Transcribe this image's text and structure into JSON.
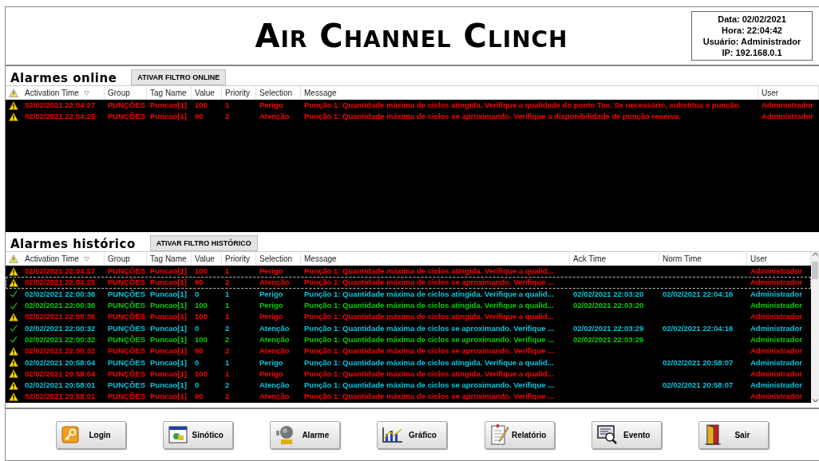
{
  "header": {
    "title": "Air Channel Clinch",
    "info": [
      "Data: 02/02/2021",
      "Hora: 22:04:42",
      "Usuário: Administrador",
      "IP: 192.168.0.1"
    ]
  },
  "online": {
    "title": "Alarmes online",
    "filter_button": "ATIVAR FILTRO ONLINE",
    "columns": [
      "Activation Time",
      "Group",
      "Tag Name",
      "Value",
      "Priority",
      "Selection",
      "Message",
      "User"
    ],
    "rows": [
      {
        "kind": "alarm",
        "color": "#ff0000",
        "cells": [
          "02/02/2021 22:04:27",
          "PUNÇÕES",
          "Puncao[1]",
          "100",
          "1",
          "Perigo",
          "Punção 1: Quantidade máxima de ciclos atingida. Verifique a qualidade do ponto Tox. Se necessário, substitua o punção.",
          "Administrador"
        ]
      },
      {
        "kind": "alarm",
        "color": "#ff0000",
        "cells": [
          "02/02/2021 22:04:25",
          "PUNÇÕES",
          "Puncao[1]",
          "90",
          "2",
          "Atenção",
          "Punção 1: Quantidade máxima de ciclos se aproximando. Verifique a disponibilidade de punção reserva.",
          "Administrador"
        ]
      }
    ]
  },
  "history": {
    "title": "Alarmes histórico",
    "filter_button": "ATIVAR FILTRO HISTÓRICO",
    "columns": [
      "Activation Time",
      "Group",
      "Tag Name",
      "Value",
      "Priority",
      "Selection",
      "Message",
      "Ack Time",
      "Norm Time",
      "User"
    ],
    "rows": [
      {
        "kind": "alarm",
        "color": "#ff0000",
        "selected": false,
        "cells": [
          "02/02/2021 22:04:27",
          "PUNÇÕES",
          "Puncao[1]",
          "100",
          "1",
          "Perigo",
          "Punção 1: Quantidade máxima de ciclos atingida. Verifique a qualid...",
          "",
          "",
          "Administrador"
        ]
      },
      {
        "kind": "alarm",
        "color": "#ff0000",
        "selected": true,
        "cells": [
          "02/02/2021 22:04:25",
          "PUNÇÕES",
          "Puncao[1]",
          "90",
          "2",
          "Atenção",
          "Punção 1: Quantidade máxima de ciclos se aproximando. Verifique ...",
          "",
          "",
          "Administrador"
        ]
      },
      {
        "kind": "ack",
        "color": "#00c8e0",
        "selected": false,
        "cells": [
          "02/02/2021 22:00:36",
          "PUNÇÕES",
          "Puncao[1]",
          "0",
          "1",
          "Perigo",
          "Punção 1: Quantidade máxima de ciclos atingida. Verifique a qualid...",
          "02/02/2021 22:03:20",
          "02/02/2021 22:04:16",
          "Administrador"
        ]
      },
      {
        "kind": "ack",
        "color": "#00d200",
        "selected": false,
        "cells": [
          "02/02/2021 22:00:36",
          "PUNÇÕES",
          "Puncao[1]",
          "100",
          "1",
          "Perigo",
          "Punção 1: Quantidade máxima de ciclos atingida. Verifique a qualid...",
          "02/02/2021 22:03:20",
          "",
          "Administrador"
        ]
      },
      {
        "kind": "alarm",
        "color": "#ff0000",
        "selected": false,
        "cells": [
          "02/02/2021 22:00:36",
          "PUNÇÕES",
          "Puncao[1]",
          "100",
          "1",
          "Perigo",
          "Punção 1: Quantidade máxima de ciclos atingida. Verifique a qualid...",
          "",
          "",
          "Administrador"
        ]
      },
      {
        "kind": "ack",
        "color": "#00c8e0",
        "selected": false,
        "cells": [
          "02/02/2021 22:00:32",
          "PUNÇÕES",
          "Puncao[1]",
          "0",
          "2",
          "Atenção",
          "Punção 1: Quantidade máxima de ciclos se aproximando. Verifique ...",
          "02/02/2021 22:03:29",
          "02/02/2021 22:04:16",
          "Administrador"
        ]
      },
      {
        "kind": "ack",
        "color": "#00d200",
        "selected": false,
        "cells": [
          "02/02/2021 22:00:32",
          "PUNÇÕES",
          "Puncao[1]",
          "100",
          "2",
          "Atenção",
          "Punção 1: Quantidade máxima de ciclos se aproximando. Verifique ...",
          "02/02/2021 22:03:29",
          "",
          "Administrador"
        ]
      },
      {
        "kind": "alarm",
        "color": "#ff0000",
        "selected": false,
        "cells": [
          "02/02/2021 22:00:32",
          "PUNÇÕES",
          "Puncao[1]",
          "90",
          "2",
          "Atenção",
          "Punção 1: Quantidade máxima de ciclos se aproximando. Verifique ...",
          "",
          "",
          "Administrador"
        ]
      },
      {
        "kind": "alarm",
        "color": "#00c8e0",
        "selected": false,
        "cells": [
          "02/02/2021 20:58:04",
          "PUNÇÕES",
          "Puncao[1]",
          "0",
          "1",
          "Perigo",
          "Punção 1: Quantidade máxima de ciclos atingida. Verifique a qualid...",
          "",
          "02/02/2021 20:58:07",
          "Administrador"
        ]
      },
      {
        "kind": "alarm",
        "color": "#ff0000",
        "selected": false,
        "cells": [
          "02/02/2021 20:58:04",
          "PUNÇÕES",
          "Puncao[1]",
          "100",
          "1",
          "Perigo",
          "Punção 1: Quantidade máxima de ciclos atingida. Verifique a qualid...",
          "",
          "",
          "Administrador"
        ]
      },
      {
        "kind": "alarm",
        "color": "#00c8e0",
        "selected": false,
        "cells": [
          "02/02/2021 20:58:01",
          "PUNÇÕES",
          "Puncao[1]",
          "0",
          "2",
          "Atenção",
          "Punção 1: Quantidade máxima de ciclos se aproximando. Verifique ...",
          "",
          "02/02/2021 20:58:07",
          "Administrador"
        ]
      },
      {
        "kind": "alarm",
        "color": "#ff0000",
        "selected": false,
        "cells": [
          "02/02/2021 20:58:01",
          "PUNÇÕES",
          "Puncao[1]",
          "90",
          "2",
          "Atenção",
          "Punção 1: Quantidade máxima de ciclos se aproximando. Verifique ...",
          "",
          "",
          "Administrador"
        ]
      }
    ]
  },
  "nav_buttons": [
    "Login",
    "Sinótico",
    "Alarme",
    "Gráfico",
    "Relatório",
    "Evento",
    "Sair"
  ]
}
